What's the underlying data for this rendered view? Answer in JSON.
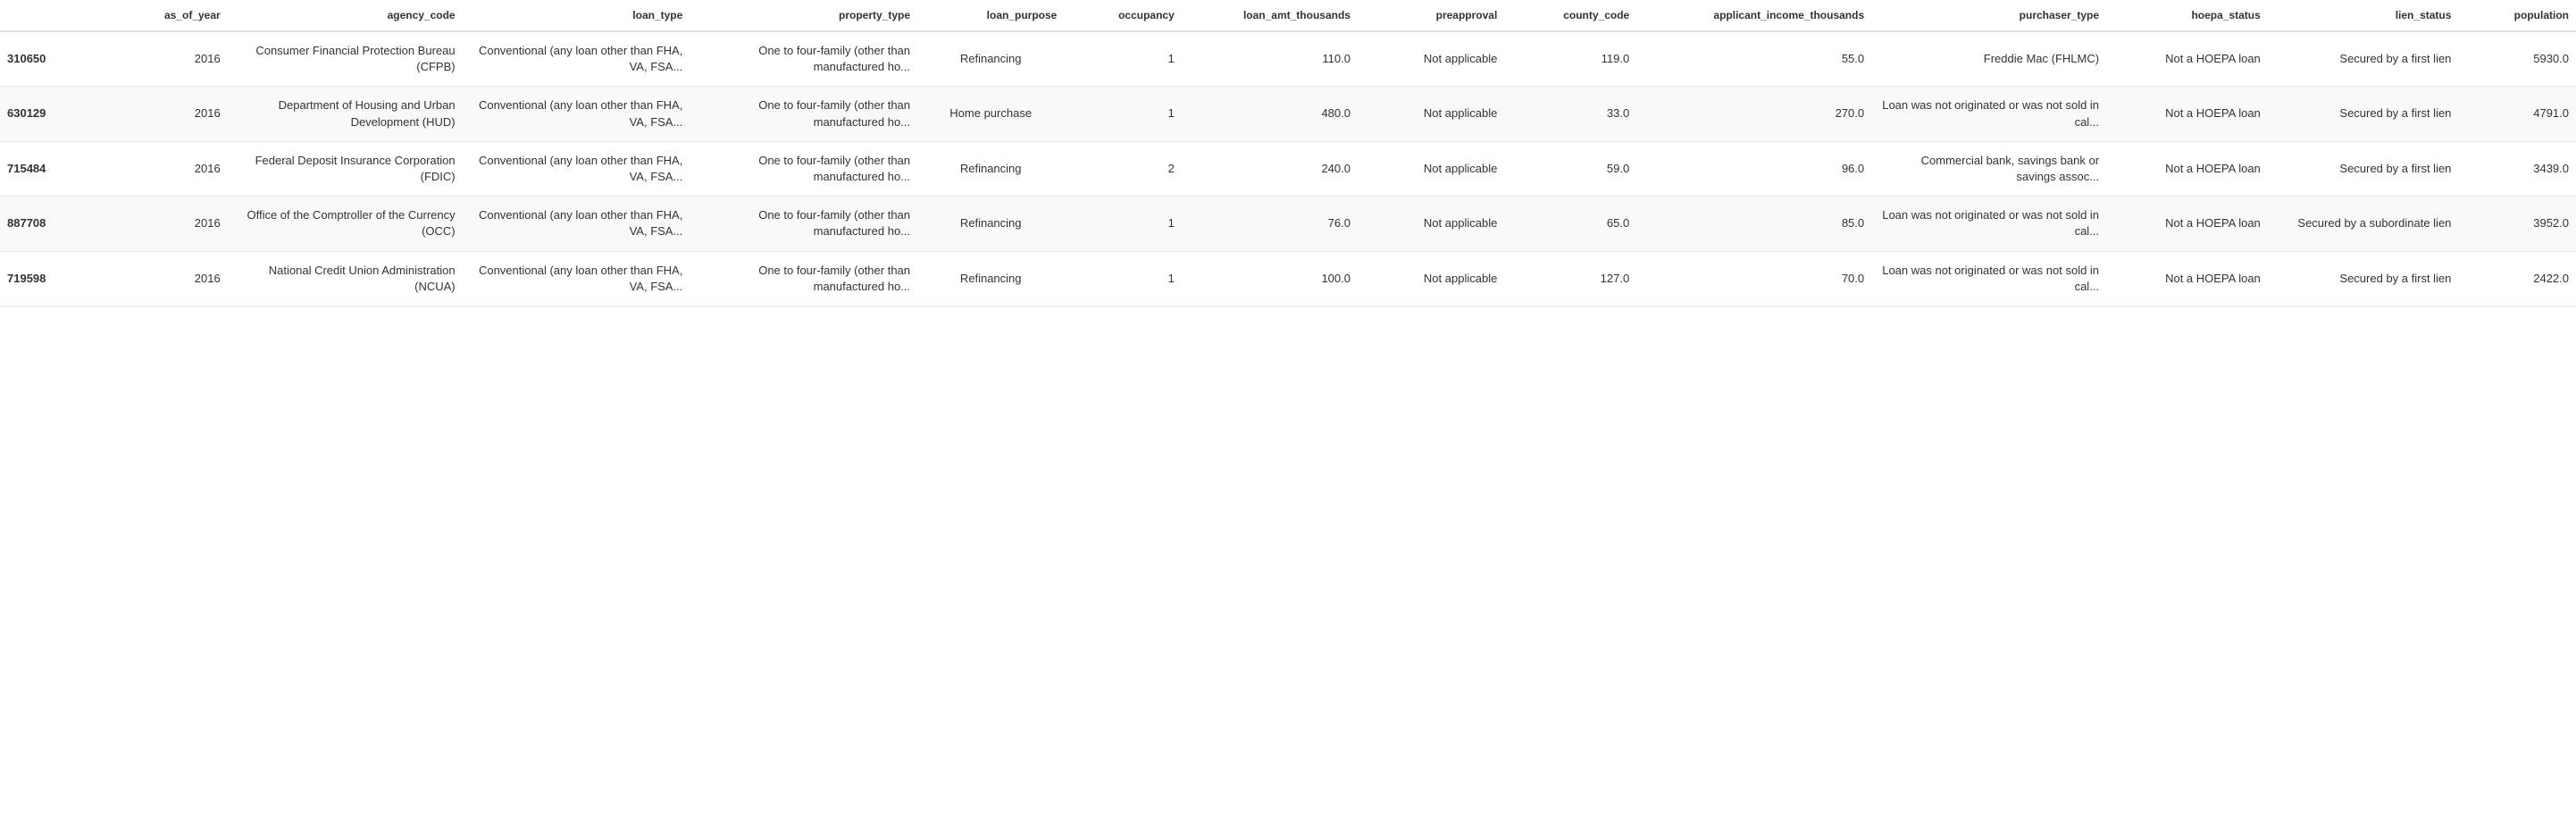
{
  "table": {
    "columns": [
      {
        "key": "id",
        "label": "",
        "align": "left"
      },
      {
        "key": "as_of_year",
        "label": "as_of_year",
        "align": "right"
      },
      {
        "key": "agency_code",
        "label": "agency_code",
        "align": "right"
      },
      {
        "key": "loan_type",
        "label": "loan_type",
        "align": "right"
      },
      {
        "key": "property_type",
        "label": "property_type",
        "align": "right"
      },
      {
        "key": "loan_purpose",
        "label": "loan_purpose",
        "align": "right"
      },
      {
        "key": "occupancy",
        "label": "occupancy",
        "align": "right"
      },
      {
        "key": "loan_amt_thousands",
        "label": "loan_amt_thousands",
        "align": "right"
      },
      {
        "key": "preapproval",
        "label": "preapproval",
        "align": "right"
      },
      {
        "key": "county_code",
        "label": "county_code",
        "align": "right"
      },
      {
        "key": "applicant_income_thousands",
        "label": "applicant_income_thousands",
        "align": "right"
      },
      {
        "key": "purchaser_type",
        "label": "purchaser_type",
        "align": "right"
      },
      {
        "key": "hoepa_status",
        "label": "hoepa_status",
        "align": "right"
      },
      {
        "key": "lien_status",
        "label": "lien_status",
        "align": "right"
      },
      {
        "key": "population",
        "label": "population",
        "align": "right"
      }
    ],
    "rows": [
      {
        "id": "310650",
        "as_of_year": "2016",
        "agency_code": "Consumer Financial Protection Bureau (CFPB)",
        "loan_type": "Conventional (any loan other than FHA, VA, FSA...",
        "property_type": "One to four-family (other than manufactured ho...",
        "loan_purpose": "Refinancing",
        "occupancy": "1",
        "loan_amt_thousands": "110.0",
        "preapproval": "Not applicable",
        "county_code": "119.0",
        "applicant_income_thousands": "55.0",
        "purchaser_type": "Freddie Mac (FHLMC)",
        "hoepa_status": "Not a HOEPA loan",
        "lien_status": "Secured by a first lien",
        "population": "5930.0"
      },
      {
        "id": "630129",
        "as_of_year": "2016",
        "agency_code": "Department of Housing and Urban Development (HUD)",
        "loan_type": "Conventional (any loan other than FHA, VA, FSA...",
        "property_type": "One to four-family (other than manufactured ho...",
        "loan_purpose": "Home purchase",
        "occupancy": "1",
        "loan_amt_thousands": "480.0",
        "preapproval": "Not applicable",
        "county_code": "33.0",
        "applicant_income_thousands": "270.0",
        "purchaser_type": "Loan was not originated or was not sold in cal...",
        "hoepa_status": "Not a HOEPA loan",
        "lien_status": "Secured by a first lien",
        "population": "4791.0"
      },
      {
        "id": "715484",
        "as_of_year": "2016",
        "agency_code": "Federal Deposit Insurance Corporation (FDIC)",
        "loan_type": "Conventional (any loan other than FHA, VA, FSA...",
        "property_type": "One to four-family (other than manufactured ho...",
        "loan_purpose": "Refinancing",
        "occupancy": "2",
        "loan_amt_thousands": "240.0",
        "preapproval": "Not applicable",
        "county_code": "59.0",
        "applicant_income_thousands": "96.0",
        "purchaser_type": "Commercial bank, savings bank or savings assoc...",
        "hoepa_status": "Not a HOEPA loan",
        "lien_status": "Secured by a first lien",
        "population": "3439.0"
      },
      {
        "id": "887708",
        "as_of_year": "2016",
        "agency_code": "Office of the Comptroller of the Currency (OCC)",
        "loan_type": "Conventional (any loan other than FHA, VA, FSA...",
        "property_type": "One to four-family (other than manufactured ho...",
        "loan_purpose": "Refinancing",
        "occupancy": "1",
        "loan_amt_thousands": "76.0",
        "preapproval": "Not applicable",
        "county_code": "65.0",
        "applicant_income_thousands": "85.0",
        "purchaser_type": "Loan was not originated or was not sold in cal...",
        "hoepa_status": "Not a HOEPA loan",
        "lien_status": "Secured by a subordinate lien",
        "population": "3952.0"
      },
      {
        "id": "719598",
        "as_of_year": "2016",
        "agency_code": "National Credit Union Administration (NCUA)",
        "loan_type": "Conventional (any loan other than FHA, VA, FSA...",
        "property_type": "One to four-family (other than manufactured ho...",
        "loan_purpose": "Refinancing",
        "occupancy": "1",
        "loan_amt_thousands": "100.0",
        "preapproval": "Not applicable",
        "county_code": "127.0",
        "applicant_income_thousands": "70.0",
        "purchaser_type": "Loan was not originated or was not sold in cal...",
        "hoepa_status": "Not a HOEPA loan",
        "lien_status": "Secured by a first lien",
        "population": "2422.0"
      }
    ]
  }
}
